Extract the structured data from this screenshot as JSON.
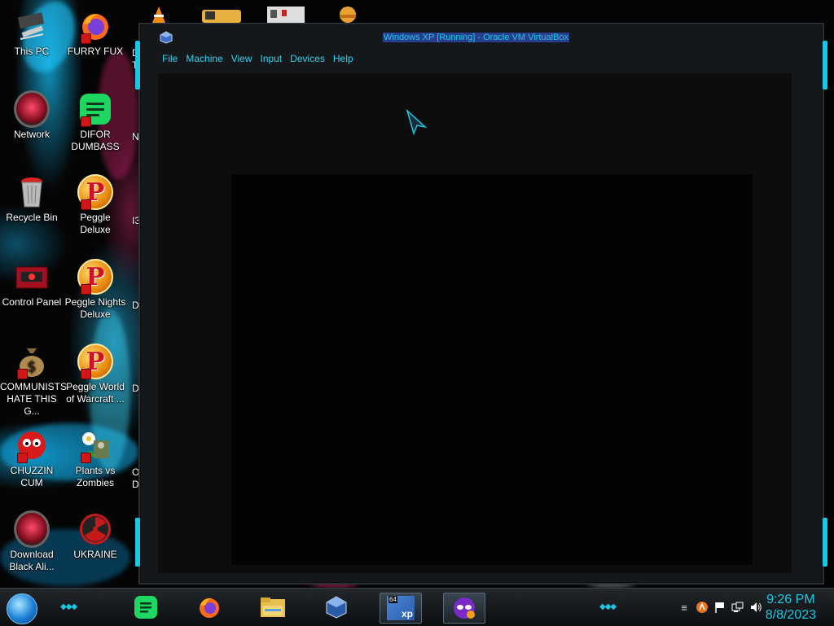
{
  "desktop": {
    "icons": [
      {
        "label": "This PC"
      },
      {
        "label": "FURRY FUX"
      },
      {
        "label": "Network"
      },
      {
        "label": "DIFOR DUMBASS"
      },
      {
        "label": "Recycle Bin"
      },
      {
        "label": "Peggle Deluxe"
      },
      {
        "label": "Control Panel"
      },
      {
        "label": "Peggle Nights Deluxe"
      },
      {
        "label": "COMMUNISTS HATE THIS G..."
      },
      {
        "label": "Peggle World of Warcraft ..."
      },
      {
        "label": "CHUZZIN CUM"
      },
      {
        "label": "Plants vs Zombies"
      },
      {
        "label": "Download Black Ali..."
      },
      {
        "label": "UKRAINE"
      }
    ],
    "partial_labels": [
      "D",
      "T",
      "NE",
      "I3",
      "DI",
      "D",
      "O",
      "D"
    ]
  },
  "window": {
    "title": "Windows XP [Running] - Oracle VM VirtualBox",
    "menu": [
      "File",
      "Machine",
      "View",
      "Input",
      "Devices",
      "Help"
    ]
  },
  "taskbar": {
    "xp_badge_top": "64",
    "xp_badge_text": "xp",
    "clock_time": "9:26 PM",
    "clock_date": "8/8/2023"
  },
  "colors": {
    "accent": "#17c9e6",
    "menu_text": "#28d2f0",
    "title_highlight": "#2a3d8c"
  }
}
